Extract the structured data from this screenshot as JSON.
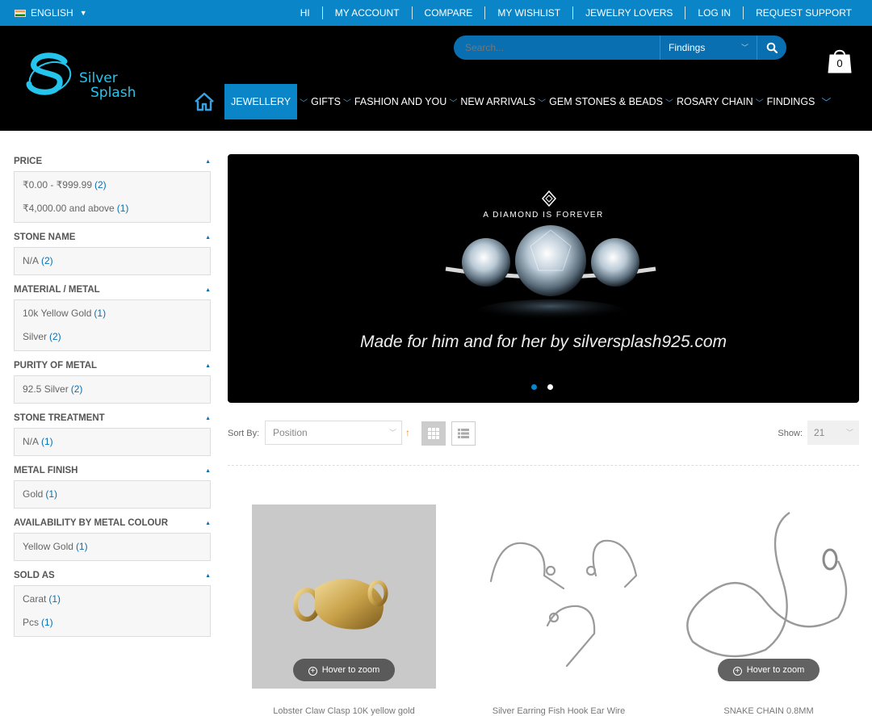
{
  "topbar": {
    "language": "ENGLISH",
    "links": [
      "HI",
      "MY ACCOUNT",
      "COMPARE",
      "MY WISHLIST",
      "JEWELRY LOVERS",
      "LOG IN",
      "REQUEST SUPPORT"
    ]
  },
  "header": {
    "logo": {
      "line1": "Silver",
      "line2": "Splash"
    },
    "search": {
      "placeholder": "Search...",
      "category": "Findings"
    },
    "cart_count": "0",
    "nav": [
      "JEWELLERY",
      "GIFTS",
      "FASHION AND YOU",
      "NEW ARRIVALS",
      "GEM STONES & BEADS",
      "ROSARY CHAIN",
      "FINDINGS"
    ]
  },
  "filters": [
    {
      "title": "PRICE",
      "items": [
        {
          "label": "₹0.00 - ₹999.99",
          "count": "(2)"
        },
        {
          "label": "₹4,000.00 and above",
          "count": "(1)"
        }
      ]
    },
    {
      "title": "STONE NAME",
      "items": [
        {
          "label": "N/A",
          "count": "(2)"
        }
      ]
    },
    {
      "title": "MATERIAL / METAL",
      "items": [
        {
          "label": "10k Yellow Gold",
          "count": "(1)"
        },
        {
          "label": "Silver",
          "count": "(2)"
        }
      ]
    },
    {
      "title": "PURITY OF METAL",
      "items": [
        {
          "label": "92.5 Silver",
          "count": "(2)"
        }
      ]
    },
    {
      "title": "STONE TREATMENT",
      "items": [
        {
          "label": "N/A",
          "count": "(1)"
        }
      ]
    },
    {
      "title": "METAL FINISH",
      "items": [
        {
          "label": "Gold",
          "count": "(1)"
        }
      ]
    },
    {
      "title": "AVAILABILITY BY METAL COLOUR",
      "items": [
        {
          "label": "Yellow Gold",
          "count": "(1)"
        }
      ]
    },
    {
      "title": "SOLD AS",
      "items": [
        {
          "label": "Carat",
          "count": "(1)"
        },
        {
          "label": "Pcs",
          "count": "(1)"
        }
      ]
    }
  ],
  "banner": {
    "brand": "A DIAMOND IS FOREVER",
    "caption": "Made for him and  for her  by silversplash925.com",
    "slide_count": 2,
    "active_slide": 1
  },
  "toolbar": {
    "sort_label": "Sort By:",
    "sort_value": "Position",
    "show_label": "Show:",
    "show_value": "21"
  },
  "products": [
    {
      "zoom_label": "Hover to zoom",
      "name": "Lobster Claw Clasp 10K yellow gold"
    },
    {
      "zoom_label": "",
      "name": "Silver Earring Fish Hook Ear Wire"
    },
    {
      "zoom_label": "Hover to zoom",
      "name": "SNAKE CHAIN 0.8MM"
    }
  ],
  "colors": {
    "accent": "#0a86c8",
    "header_bg": "#000000",
    "logo": "#25c4ec"
  }
}
